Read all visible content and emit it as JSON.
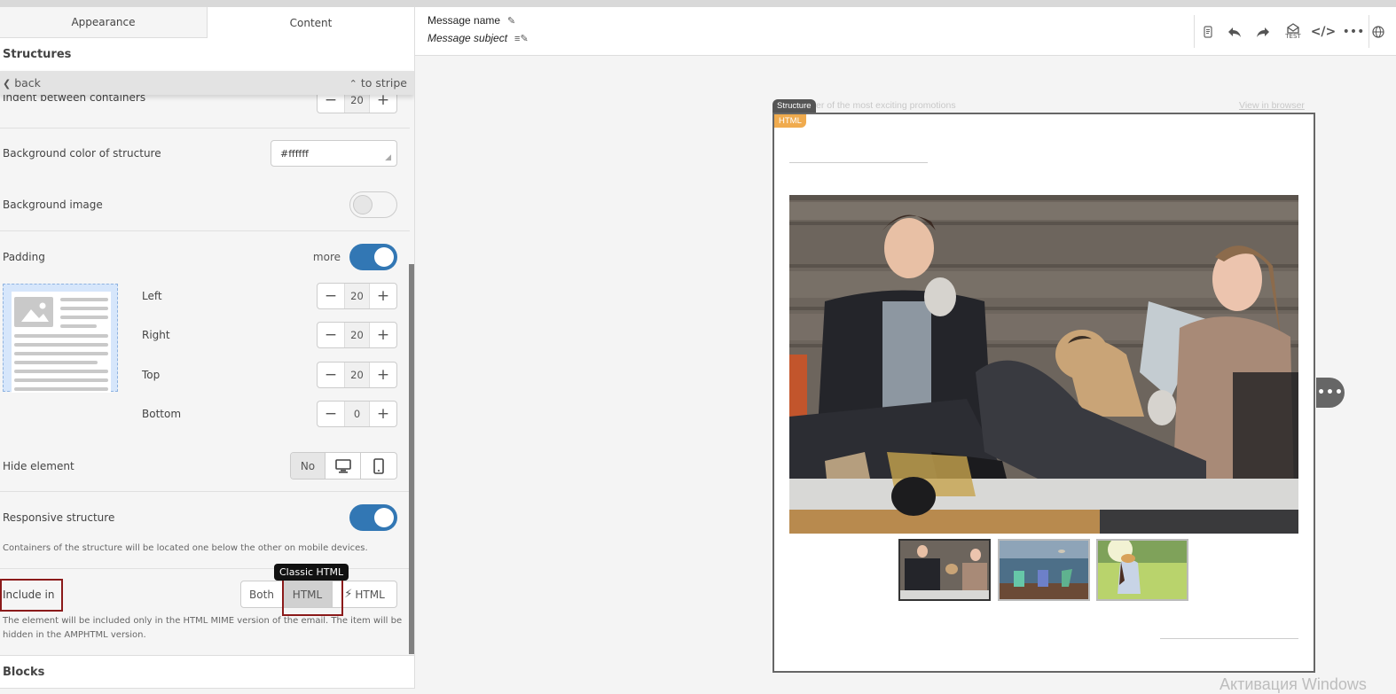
{
  "left_panel": {
    "tabs": [
      {
        "label": "Appearance",
        "active": false
      },
      {
        "label": "Content",
        "active": true
      }
    ],
    "section_title": "Structures",
    "back_label": "back",
    "to_stripe_label": "to stripe",
    "indent_between_containers": {
      "label": "Indent between containers",
      "value": "20"
    },
    "background_color": {
      "label": "Background color of structure",
      "value": "#ffffff"
    },
    "background_image": {
      "label": "Background image",
      "enabled": false
    },
    "padding": {
      "label": "Padding",
      "more_label": "more",
      "enabled": true,
      "left": {
        "label": "Left",
        "value": "20"
      },
      "right": {
        "label": "Right",
        "value": "20"
      },
      "top": {
        "label": "Top",
        "value": "20"
      },
      "bottom": {
        "label": "Bottom",
        "value": "0"
      }
    },
    "hide_element": {
      "label": "Hide element",
      "options": [
        "No",
        "desktop-icon",
        "mobile-icon"
      ],
      "selected": "No"
    },
    "responsive_structure": {
      "label": "Responsive structure",
      "enabled": true,
      "note": "Containers of the structure will be located one below the other on mobile devices."
    },
    "include_in": {
      "label": "Include in",
      "options": [
        "Both",
        "HTML",
        "HTML"
      ],
      "amp_icon": "lightning-icon",
      "selected": "HTML",
      "tooltip": "Classic HTML",
      "note_line1": "The element will be included only in the HTML MIME version of the email. The item will be",
      "note_line2": "hidden in the AMPHTML version."
    },
    "blocks_title": "Blocks"
  },
  "header": {
    "message_name": "Message name",
    "message_subject": "Message subject",
    "toolbar": [
      "mobile-preview-icon",
      "undo-icon",
      "redo-icon",
      "test-email-icon",
      "code-icon",
      "more-icon",
      "globe-icon"
    ],
    "test_label": "TEST"
  },
  "canvas": {
    "preheader": "er of the most exciting promotions",
    "view_in_browser": "View in browser",
    "structure_badge": "Structure",
    "html_badge": "HTML",
    "more_handle": "•••",
    "thumbnails": [
      {
        "name": "friends-on-porch",
        "active": true
      },
      {
        "name": "beach-chairs",
        "active": false
      },
      {
        "name": "woman-in-meadow",
        "active": false
      }
    ]
  },
  "watermark": "Активация Windows",
  "colors": {
    "toggle_on": "#3277b4",
    "html_badge": "#f0ab4e",
    "highlight": "#8b1a1a"
  }
}
